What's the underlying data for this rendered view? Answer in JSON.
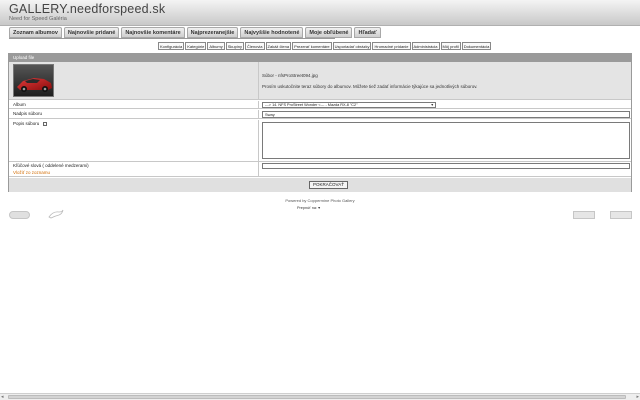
{
  "header": {
    "title": "GALLERY.needforspeed.sk",
    "subtitle": "Need for Speed Galéria"
  },
  "mainnav": [
    "Zoznam albumov",
    "Najnovšie pridané",
    "Najnovšie komentáre",
    "Najprezeranejšie",
    "Najvyššie hodnotené",
    "Moje obľúbené",
    "Hľadať"
  ],
  "admintabs": [
    "Konfigurácia",
    "Kategórie",
    "Albumy",
    "Skupiny",
    "Členovia",
    "Zakáž člena",
    "Prezerať komentáre",
    "Usporiadať obrázky",
    "Hromadné pridanie",
    "Administrácia",
    "Môj profil",
    "Dokumentácia"
  ],
  "form": {
    "heading": "Upload file",
    "file_name": "Súbor - nfsProStreet094.jpg",
    "file_desc": "Prosím uskutočnite teraz súbory do albumov. Môžete tiež zadať informácie týkajúce sa jednotlivých súborov.",
    "album_label": "Album",
    "album_value": "---> 14. NFS ProStreet Wonder <--- - Mazda RX-8 \"C2\"",
    "title_label": "Nadpis súboru",
    "title_value": "Sway",
    "desc_label": "Popis súboru",
    "keywords_label": "Kľúčové slová ( oddelené medzerami)",
    "keywords_link": "Vložiť zo zoznamu",
    "submit_label": "POKRAČOVAŤ"
  },
  "footer": {
    "powered": "Powered by Coppermine Photo Gallery",
    "language": "Prepnúť na:"
  }
}
